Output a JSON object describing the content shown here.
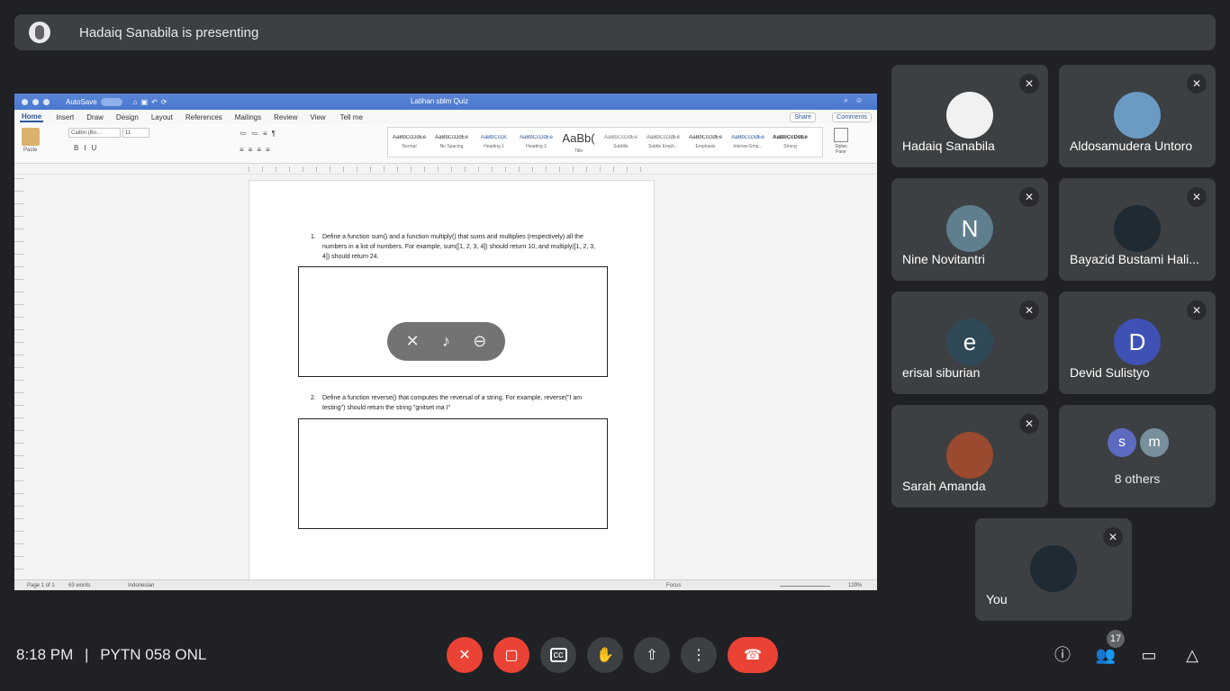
{
  "presenter_bar": {
    "text": "Hadaiq Sanabila is presenting"
  },
  "word": {
    "autosave": "AutoSave",
    "doc_title": "Latihan sblm Quiz",
    "tabs": [
      "Home",
      "Insert",
      "Draw",
      "Design",
      "Layout",
      "References",
      "Mailings",
      "Review",
      "View"
    ],
    "tell_me": "Tell me",
    "share": "Share",
    "comments": "Comments",
    "font_name": "Calibri (Bo...",
    "font_size": "11",
    "paste_label": "Paste",
    "styles": [
      {
        "sample": "AaBbCcDdEe",
        "name": "Normal"
      },
      {
        "sample": "AaBbCcDdEe",
        "name": "No Spacing"
      },
      {
        "sample": "AaBbCcDc",
        "name": "Heading 1"
      },
      {
        "sample": "AaBbCcDdEe",
        "name": "Heading 2"
      },
      {
        "sample": "AaBb(",
        "name": "Title"
      },
      {
        "sample": "AaBbCcDdEe",
        "name": "Subtitle"
      },
      {
        "sample": "AaBbCcDdEe",
        "name": "Subtle Emph..."
      },
      {
        "sample": "AaBbCcDdEe",
        "name": "Emphasis"
      },
      {
        "sample": "AaBbCcDdEe",
        "name": "Intense Emp..."
      },
      {
        "sample": "AaBbCcDdEe",
        "name": "Strong"
      }
    ],
    "styles_pane": "Styles Pane",
    "q1_num": "1.",
    "q1": "Define a function sum() and a function multiply() that sums and multiplies (respectively) all the numbers in a list of numbers. For example, sum([1, 2, 3, 4]) should return 10, and multiply([1, 2, 3, 4]) should return 24.",
    "q2_num": "2.",
    "q2": "Define a function reverse() that computes the reversal of a string. For example, reverse(\"I am testing\") should return the string \"gnitset ma I\"",
    "status": {
      "page": "Page 1 of 1",
      "words": "63 words",
      "lang": "Indonesian",
      "focus": "Focus",
      "zoom": "129%"
    }
  },
  "participants": [
    {
      "name": "Hadaiq Sanabila",
      "initial": "",
      "color": "#f1f1f1"
    },
    {
      "name": "Aldosamudera Untoro",
      "initial": "",
      "color": "#6b9bc3"
    },
    {
      "name": "Nine Novitantri",
      "initial": "N",
      "color": "#5f7f8f"
    },
    {
      "name": "Bayazid Bustami Hali...",
      "initial": "",
      "color": "#1f2a33"
    },
    {
      "name": "erisal siburian",
      "initial": "e",
      "color": "#2f4a56"
    },
    {
      "name": "Devid Sulistyo",
      "initial": "D",
      "color": "#3f51b5"
    },
    {
      "name": "Sarah Amanda",
      "initial": "",
      "color": "#9a4a2e"
    },
    {
      "name": "You",
      "initial": "",
      "color": "#1f2a33"
    }
  ],
  "others": {
    "label": "8 others",
    "a": "s",
    "b": "m"
  },
  "bottom": {
    "time": "8:18 PM",
    "separator": "|",
    "meeting": "PYTN 058 ONL",
    "people_count": "17"
  }
}
